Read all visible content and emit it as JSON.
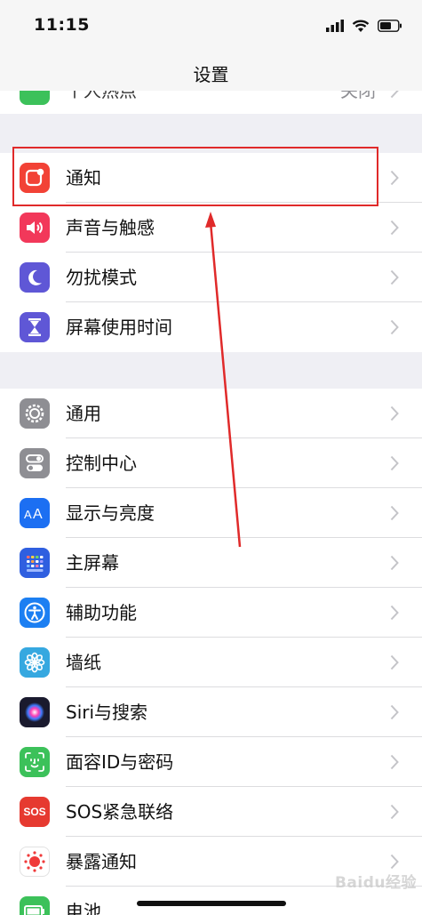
{
  "status_bar": {
    "time": "11:15"
  },
  "nav": {
    "title": "设置"
  },
  "partial_row": {
    "label": "个人热点",
    "value": "关闭"
  },
  "group1": [
    {
      "label": "通知",
      "icon": "notifications-icon",
      "color": "#f24236"
    },
    {
      "label": "声音与触感",
      "icon": "sound-icon",
      "color": "#f2385a"
    },
    {
      "label": "勿扰模式",
      "icon": "moon-icon",
      "color": "#5f57d6"
    },
    {
      "label": "屏幕使用时间",
      "icon": "hourglass-icon",
      "color": "#5f57d6"
    }
  ],
  "group2": [
    {
      "label": "通用",
      "icon": "gear-icon",
      "color": "#8e8e93"
    },
    {
      "label": "控制中心",
      "icon": "toggles-icon",
      "color": "#8e8e93"
    },
    {
      "label": "显示与亮度",
      "icon": "text-size-icon",
      "color": "#1c6ff2"
    },
    {
      "label": "主屏幕",
      "icon": "home-grid-icon",
      "color": "#2f5fe0"
    },
    {
      "label": "辅助功能",
      "icon": "accessibility-icon",
      "color": "#1c7ff2"
    },
    {
      "label": "墙纸",
      "icon": "flower-icon",
      "color": "#36a8e0"
    },
    {
      "label": "Siri与搜索",
      "icon": "siri-icon",
      "color": "#1a1a2e"
    },
    {
      "label": "面容ID与密码",
      "icon": "face-id-icon",
      "color": "#3cc15a"
    },
    {
      "label": "SOS紧急联络",
      "icon": "sos-icon",
      "color": "#e63a30",
      "icon_text": "SOS"
    },
    {
      "label": "暴露通知",
      "icon": "exposure-icon",
      "color": "#ffffff"
    },
    {
      "label": "电池",
      "icon": "battery-icon",
      "color": "#3cc15a"
    }
  ],
  "watermark": "Baidu经验"
}
